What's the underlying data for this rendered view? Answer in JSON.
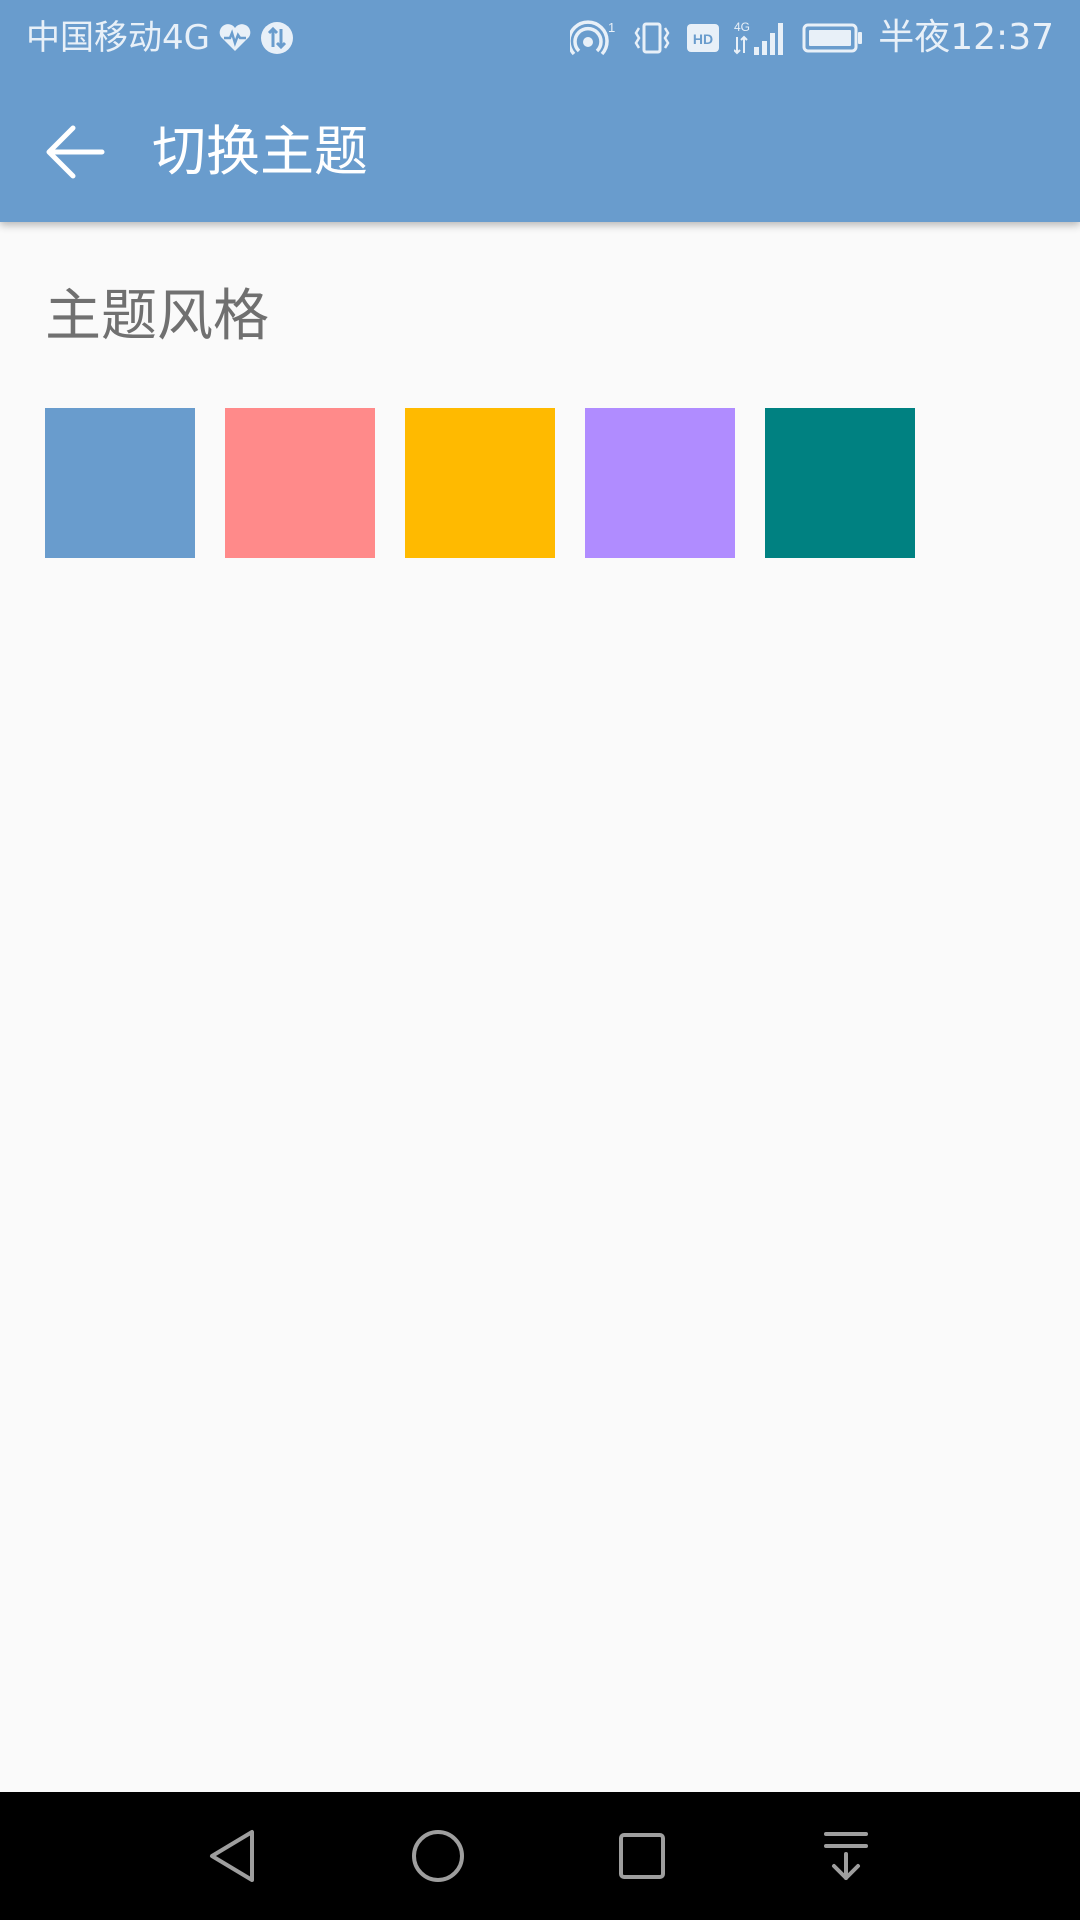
{
  "status_bar": {
    "carrier": "中国移动4G",
    "clock": "半夜12:37",
    "network_label": "4G",
    "hd_label": "HD",
    "hotspot_count": "1"
  },
  "toolbar": {
    "title": "切换主题"
  },
  "section": {
    "title": "主题风格"
  },
  "theme_swatches": [
    {
      "color": "#699CCD"
    },
    {
      "color": "#FF8A8A"
    },
    {
      "color": "#FFBA00"
    },
    {
      "color": "#B08CFF"
    },
    {
      "color": "#008181"
    }
  ],
  "colors": {
    "primary": "#699CCD",
    "background": "#FAFAFA",
    "nav_bar": "#000000"
  }
}
